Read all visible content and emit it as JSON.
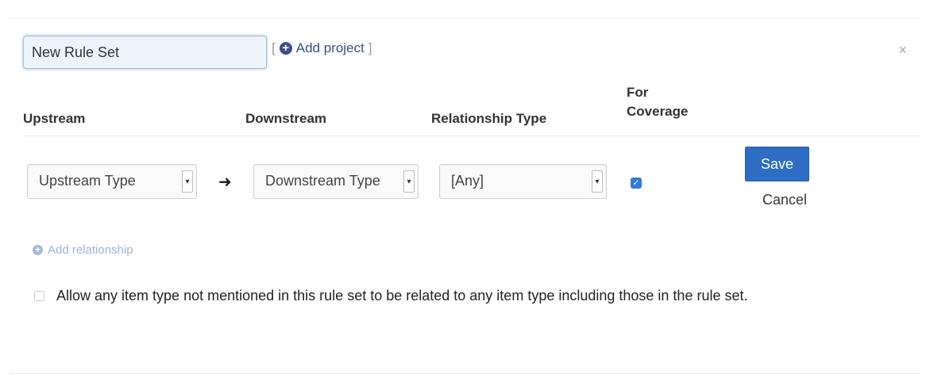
{
  "rule_set": {
    "name_value": "New Rule Set",
    "add_project_label": "Add project",
    "close_symbol": "×"
  },
  "headers": {
    "upstream": "Upstream",
    "downstream": "Downstream",
    "relationship_type": "Relationship Type",
    "for_coverage_line1": "For",
    "for_coverage_line2": "Coverage"
  },
  "row": {
    "upstream_select": "Upstream Type",
    "downstream_select": "Downstream Type",
    "relationship_select": "[Any]",
    "for_coverage_checked": true,
    "arrow_symbol": "➜"
  },
  "actions": {
    "save_label": "Save",
    "cancel_label": "Cancel",
    "add_relationship_label": "Add relationship"
  },
  "options": {
    "allow_any_label": "Allow any item type not mentioned in this rule set to be related to any item type including those in the rule set.",
    "allow_any_checked": false
  },
  "colors": {
    "accent": "#2d6ec4",
    "link": "#3a4f8a"
  },
  "icons": {
    "add_project": "plus-circle-icon",
    "close": "close-icon",
    "add_relationship": "plus-circle-icon",
    "arrow": "arrow-right-icon",
    "select_caret": "chevron-down-icon"
  }
}
